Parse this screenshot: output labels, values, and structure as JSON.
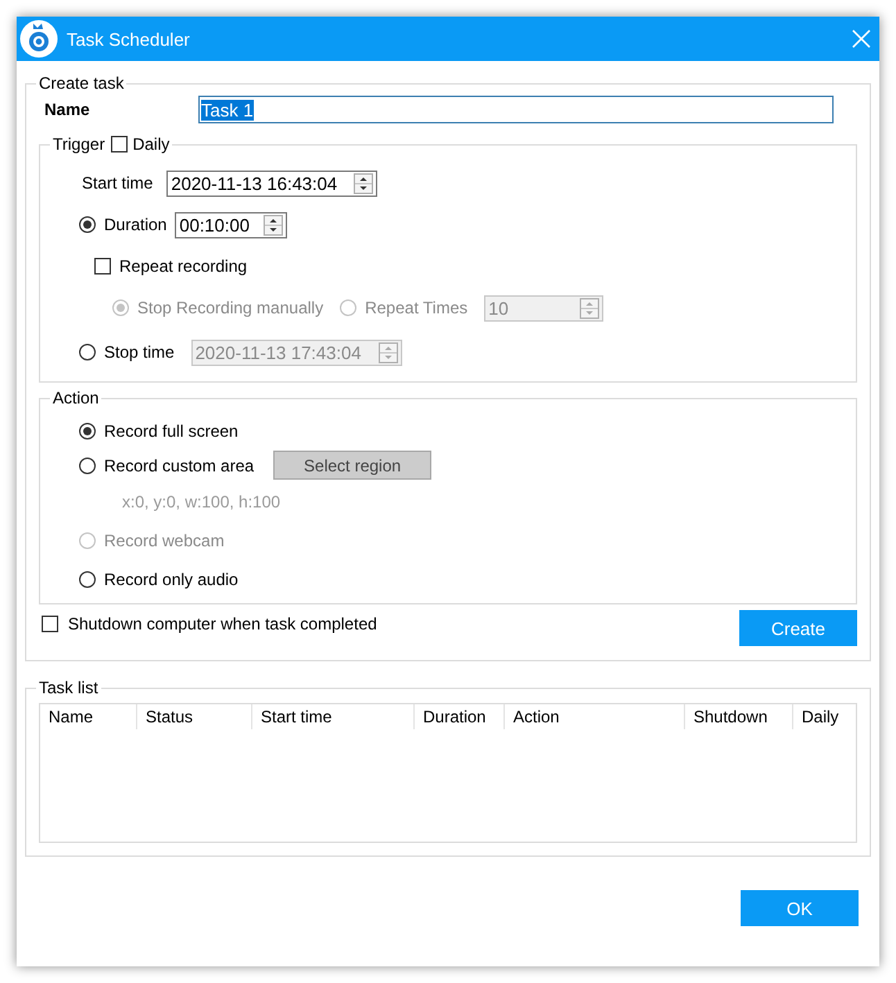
{
  "window": {
    "title": "Task Scheduler"
  },
  "create_task": {
    "legend": "Create task",
    "name_label": "Name",
    "name_value": "Task 1",
    "trigger": {
      "legend": "Trigger",
      "daily": {
        "label": "Daily",
        "checked": false
      },
      "start_time": {
        "label": "Start time",
        "value": "2020-11-13 16:43:04"
      },
      "duration": {
        "label": "Duration",
        "selected": true,
        "value": "00:10:00"
      },
      "repeat": {
        "label": "Repeat recording",
        "checked": false,
        "options": [
          {
            "label": "Stop Recording manually",
            "selected": true,
            "disabled": true
          },
          {
            "label": "Repeat Times",
            "selected": false,
            "disabled": true,
            "value": "10"
          }
        ]
      },
      "stop_time": {
        "label": "Stop time",
        "selected": false,
        "disabled": true,
        "value": "2020-11-13 17:43:04"
      }
    },
    "action": {
      "legend": "Action",
      "options": [
        {
          "label": "Record full screen",
          "selected": true,
          "disabled": false
        },
        {
          "label": "Record custom area",
          "selected": false,
          "disabled": false,
          "button": "Select region",
          "region": "x:0, y:0, w:100, h:100"
        },
        {
          "label": "Record webcam",
          "selected": false,
          "disabled": true
        },
        {
          "label": "Record only audio",
          "selected": false,
          "disabled": false
        }
      ]
    },
    "shutdown": {
      "label": "Shutdown computer when task completed",
      "checked": false
    },
    "create_button": "Create"
  },
  "task_list": {
    "legend": "Task list",
    "columns": [
      "Name",
      "Status",
      "Start time",
      "Duration",
      "Action",
      "Shutdown",
      "Daily"
    ]
  },
  "ok_button": "OK"
}
